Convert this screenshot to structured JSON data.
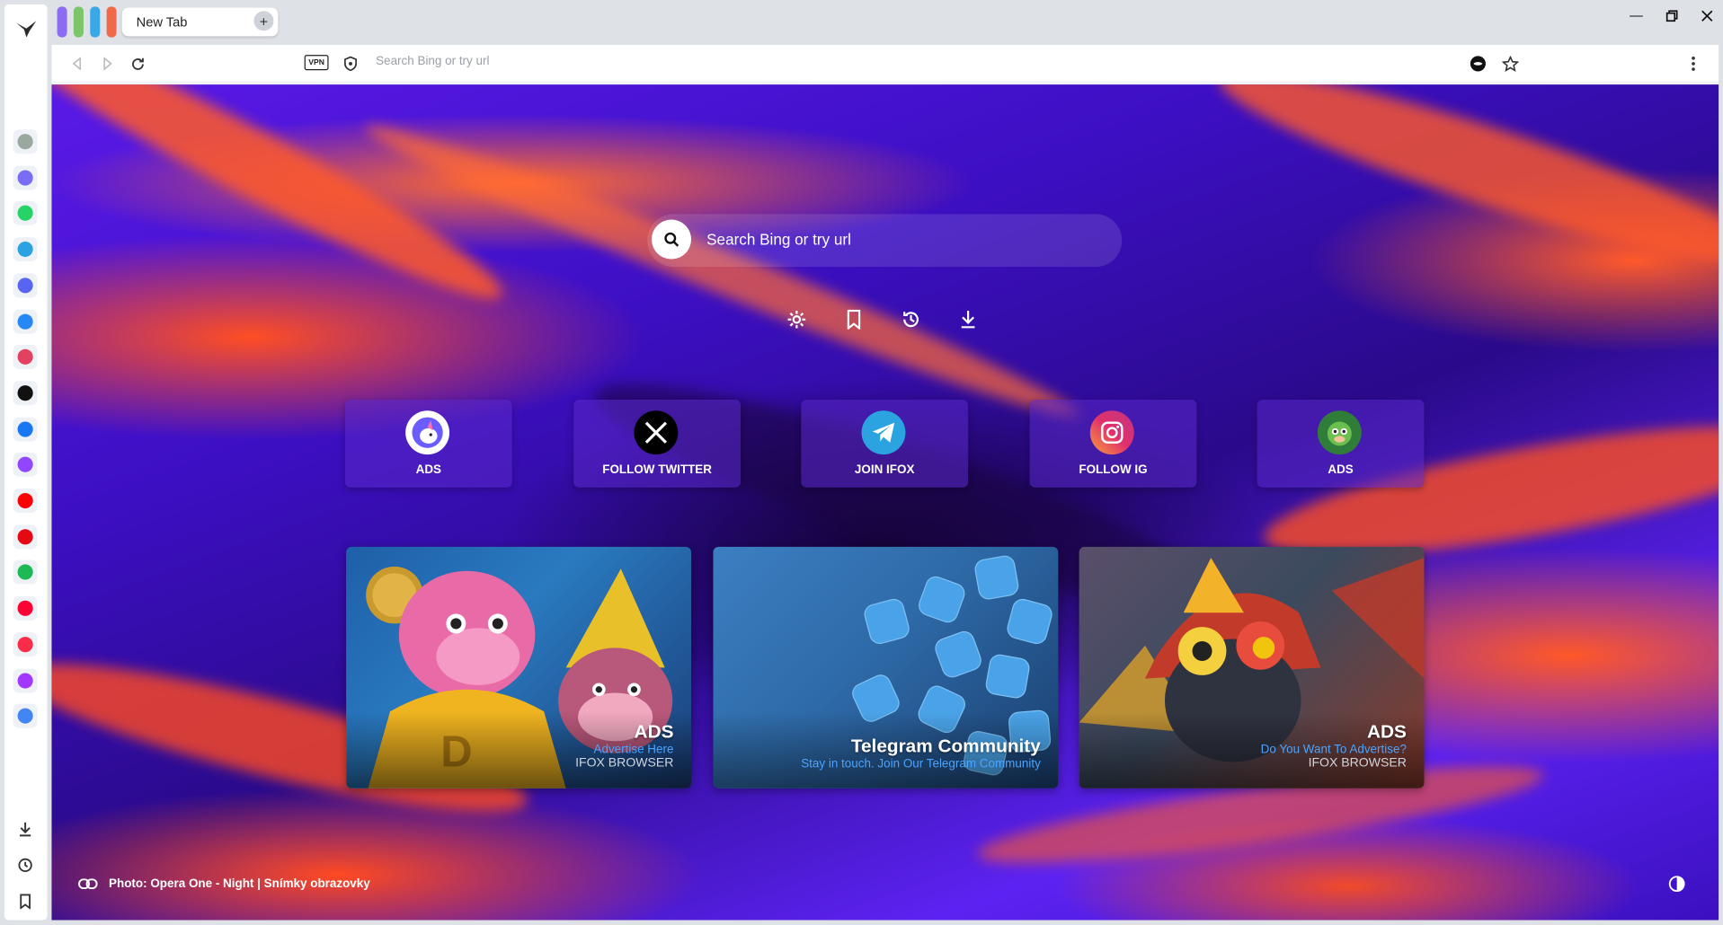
{
  "tab": {
    "title": "New Tab"
  },
  "toolbar": {
    "vpn_label": "VPN",
    "url_placeholder": "Search Bing or try url"
  },
  "sidebar": {
    "items": [
      {
        "icon": "chatgpt-icon",
        "color": "#9aa9a0"
      },
      {
        "icon": "messenger-icon",
        "color": "#7b6cf6"
      },
      {
        "icon": "whatsapp-icon",
        "color": "#25d366"
      },
      {
        "icon": "telegram-icon",
        "color": "#2aa3e0"
      },
      {
        "icon": "discord-icon",
        "color": "#5865f2"
      },
      {
        "icon": "vk-icon",
        "color": "#2787f5"
      },
      {
        "icon": "instagram-icon",
        "color": "#e4405f"
      },
      {
        "icon": "x-icon",
        "color": "#111111"
      },
      {
        "icon": "facebook-icon",
        "color": "#1877f2"
      },
      {
        "icon": "twitch-icon",
        "color": "#9146ff"
      },
      {
        "icon": "youtube-icon",
        "color": "#ff0000"
      },
      {
        "icon": "netflix-icon",
        "color": "#e50914"
      },
      {
        "icon": "spotify-icon",
        "color": "#1db954"
      },
      {
        "icon": "youtube-music-icon",
        "color": "#ff0033"
      },
      {
        "icon": "apple-music-icon",
        "color": "#fa2d48"
      },
      {
        "icon": "deezer-icon",
        "color": "#a238ff"
      },
      {
        "icon": "translate-icon",
        "color": "#4285f4"
      }
    ]
  },
  "search": {
    "placeholder": "Search Bing or try url"
  },
  "tiles": [
    {
      "label": "ADS",
      "icon": "unicorn-icon",
      "color": "#6a5cff"
    },
    {
      "label": "FOLLOW TWITTER",
      "icon": "x-icon",
      "color": "#000000"
    },
    {
      "label": "JOIN IFOX",
      "icon": "telegram-icon",
      "color": "#2aa3e0"
    },
    {
      "label": "FOLLOW IG",
      "icon": "instagram-icon",
      "color": "#e4405f"
    },
    {
      "label": "ADS",
      "icon": "monkey-icon",
      "color": "#4caf50"
    }
  ],
  "cards": [
    {
      "title": "ADS",
      "subtitle": "Advertise Here",
      "brand": "IFOX BROWSER"
    },
    {
      "title": "Telegram Community",
      "subtitle": "Stay in touch. Join Our Telegram Community",
      "brand": ""
    },
    {
      "title": "ADS",
      "subtitle": "Do You Want To Advertise?",
      "brand": "IFOX BROWSER"
    }
  ],
  "footer": {
    "credit": "Photo: Opera One - Night | Snímky obrazovky"
  }
}
